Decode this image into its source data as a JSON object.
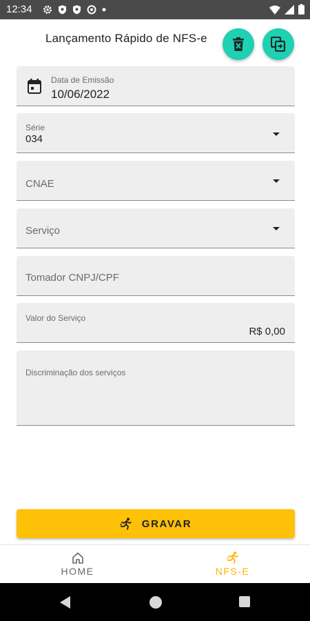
{
  "status_bar": {
    "time": "12:34"
  },
  "header": {
    "title": "Lançamento Rápido de NFS-e"
  },
  "form": {
    "data_emissao": {
      "label": "Data de Emissão",
      "value": "10/06/2022"
    },
    "serie": {
      "label": "Série",
      "value": "034"
    },
    "cnae": {
      "placeholder": "CNAE"
    },
    "servico": {
      "placeholder": "Serviço"
    },
    "tomador": {
      "placeholder": "Tomador CNPJ/CPF"
    },
    "valor_servico": {
      "label": "Valor do Serviço",
      "value": "R$ 0,00"
    },
    "discriminacao": {
      "label": "Discriminação dos serviços"
    }
  },
  "actions": {
    "gravar_label": "GRAVAR"
  },
  "bottom_nav": {
    "items": [
      {
        "label": "HOME",
        "icon": "home-icon",
        "active": false
      },
      {
        "label": "NFS-E",
        "icon": "running-icon",
        "active": true
      }
    ]
  },
  "colors": {
    "fab": "#1fd1b3",
    "accent": "#ffc107",
    "active_nav": "#ffb300",
    "field_bg": "#eeeeee"
  }
}
